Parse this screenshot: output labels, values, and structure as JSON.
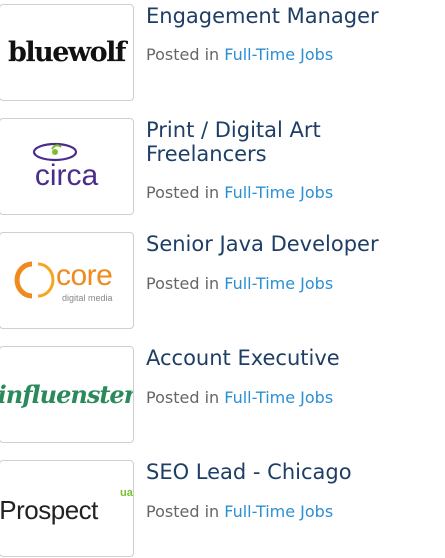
{
  "jobs": [
    {
      "title": "Engagement Manager",
      "posted_prefix": "Posted in",
      "category": "Full-Time Jobs",
      "logo": {
        "name": "bluewolf",
        "text": "bluewolf"
      }
    },
    {
      "title": "Print / Digital Art Freelancers",
      "posted_prefix": "Posted in",
      "category": "Full-Time Jobs",
      "logo": {
        "name": "circa",
        "text": "circa"
      }
    },
    {
      "title": "Senior Java Developer",
      "posted_prefix": "Posted in",
      "category": "Full-Time Jobs",
      "logo": {
        "name": "core digital media",
        "text": "core",
        "subtext": "digital media"
      }
    },
    {
      "title": "Account Executive",
      "posted_prefix": "Posted in",
      "category": "Full-Time Jobs",
      "logo": {
        "name": "influenster",
        "text": "influenster"
      }
    },
    {
      "title": "SEO Lead - Chicago",
      "posted_prefix": "Posted in",
      "category": "Full-Time Jobs",
      "logo": {
        "name": "iProspect",
        "text": "iProspect",
        "badge": "ua"
      }
    }
  ],
  "colors": {
    "title": "#1f3e66",
    "meta": "#666666",
    "link": "#2b8fd3",
    "border": "#cfcfcf"
  }
}
